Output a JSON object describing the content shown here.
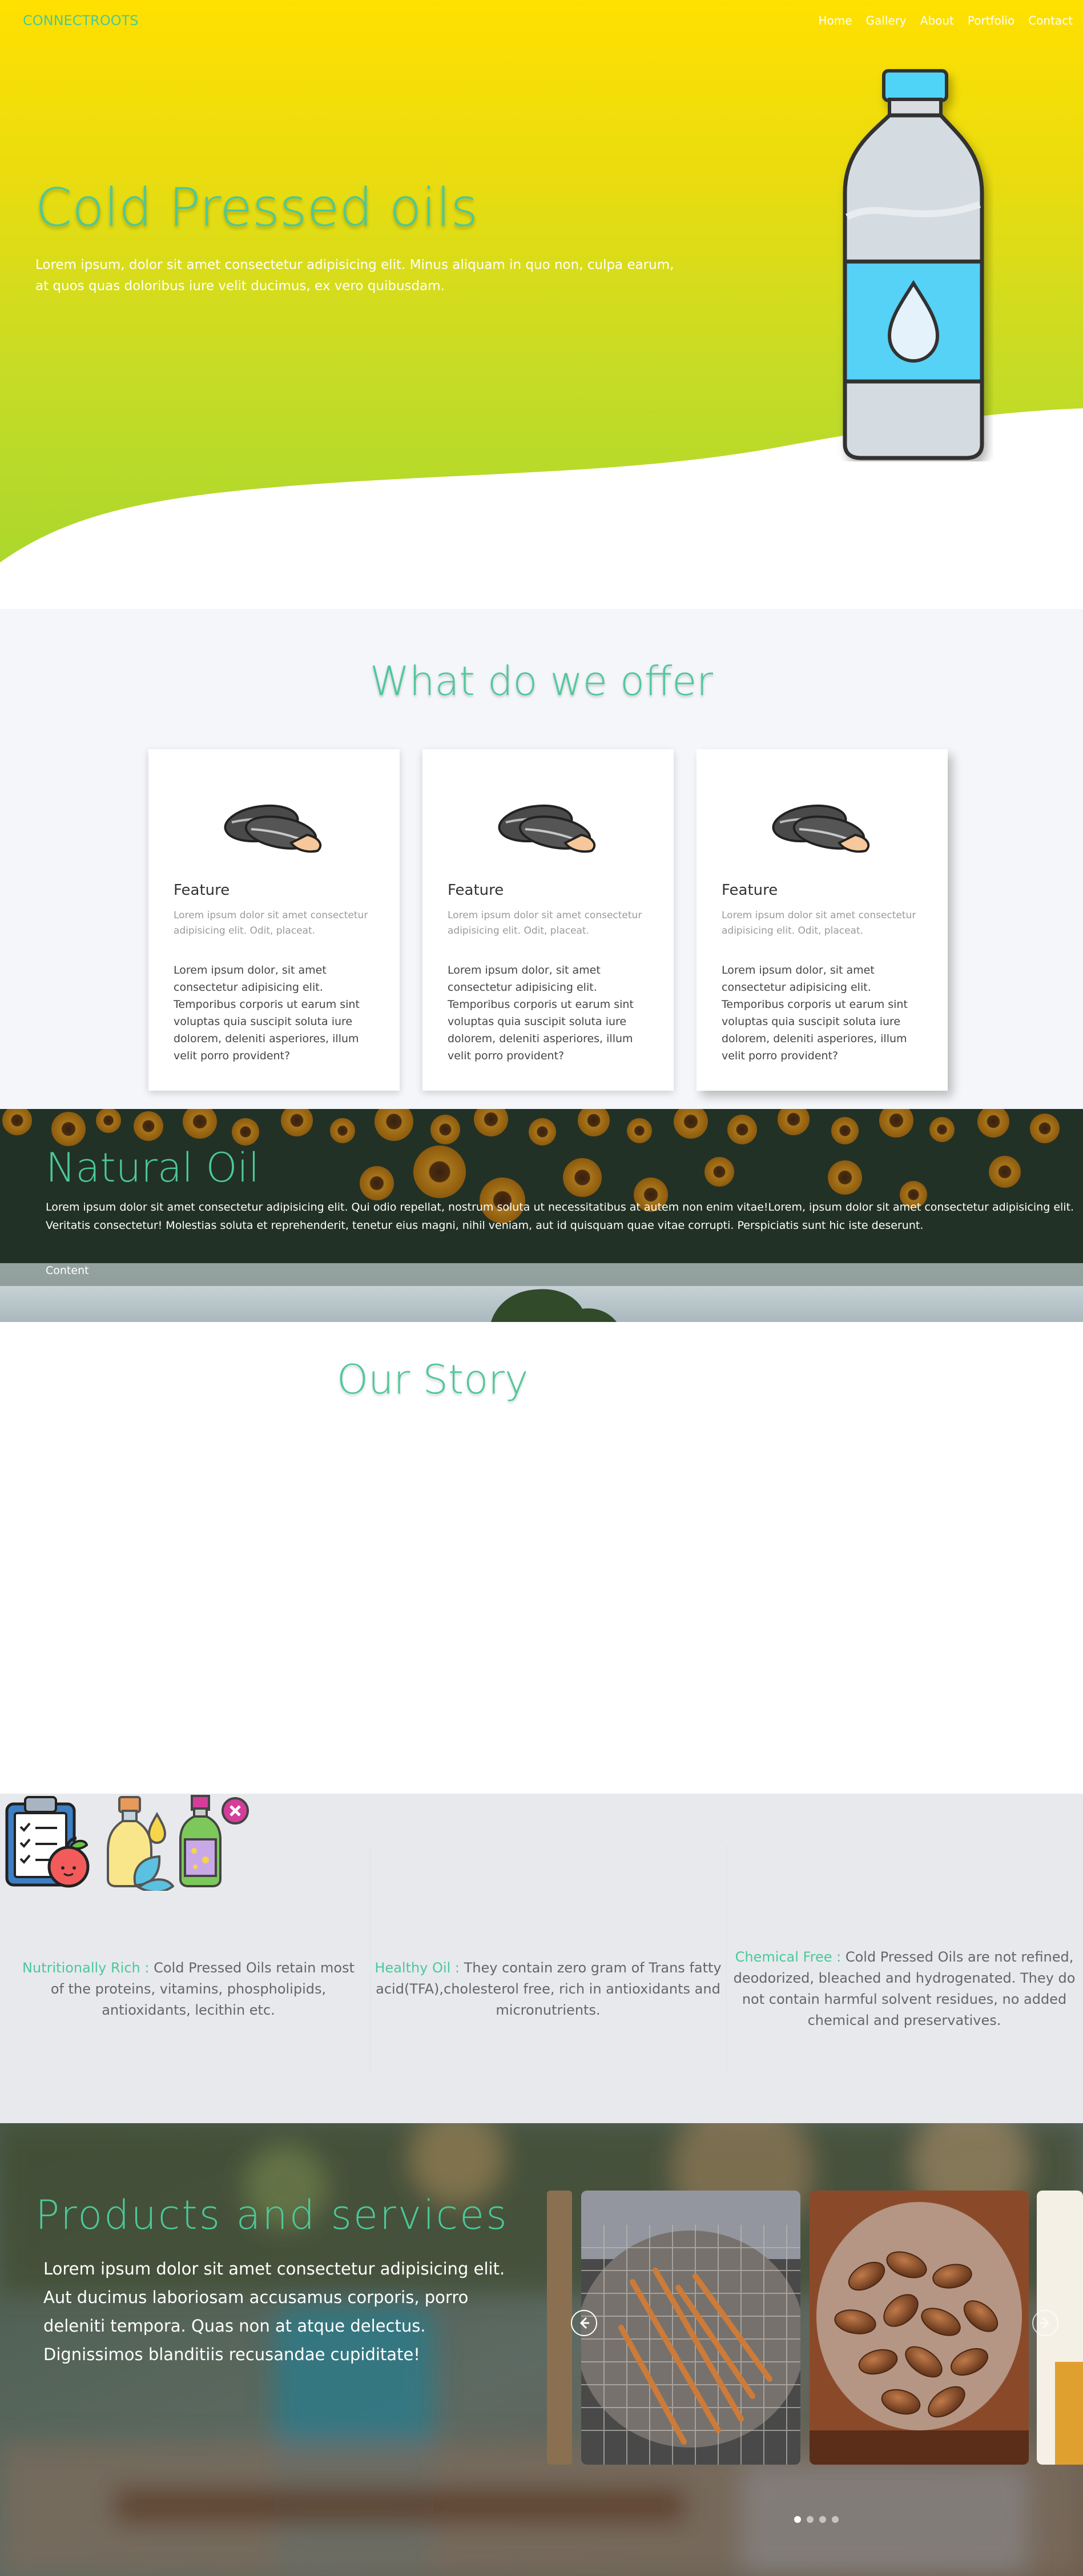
{
  "nav": {
    "brand": "CONNECTROOTS",
    "links": [
      "Home",
      "Gallery",
      "About",
      "Portfolio",
      "Contact"
    ]
  },
  "hero": {
    "title": "Cold Pressed oils",
    "text": "Lorem ipsum, dolor sit amet consectetur adipisicing elit. Minus aliquam in quo non, culpa earum, at quos quas doloribus iure velit ducimus, ex vero quibusdam."
  },
  "offer": {
    "title": "What do we offer",
    "cards": [
      {
        "title": "Feature",
        "subtitle": "Lorem ipsum dolor sit amet consectetur adipisicing elit. Odit, placeat.",
        "body": "Lorem ipsum dolor, sit amet consectetur adipisicing elit. Temporibus corporis ut earum sint voluptas quia suscipit soluta iure dolorem, deleniti asperiores, illum velit porro provident?"
      },
      {
        "title": "Feature",
        "subtitle": "Lorem ipsum dolor sit amet consectetur adipisicing elit. Odit, placeat.",
        "body": "Lorem ipsum dolor, sit amet consectetur adipisicing elit. Temporibus corporis ut earum sint voluptas quia suscipit soluta iure dolorem, deleniti asperiores, illum velit porro provident?"
      },
      {
        "title": "Feature",
        "subtitle": "Lorem ipsum dolor sit amet consectetur adipisicing elit. Odit, placeat.",
        "body": "Lorem ipsum dolor, sit amet consectetur adipisicing elit. Temporibus corporis ut earum sint voluptas quia suscipit soluta iure dolorem, deleniti asperiores, illum velit porro provident?"
      }
    ]
  },
  "natural": {
    "title": "Natural Oil",
    "text": "Lorem ipsum dolor sit amet consectetur adipisicing elit. Qui odio repellat, nostrum soluta ut necessitatibus at autem non enim vitae!Lorem, ipsum dolor sit amet consectetur adipisicing elit. Veritatis consectetur! Molestias soluta et reprehenderit, tenetur eius magni, nihil veniam, aut id quisquam quae vitae corrupti. Perspiciatis sunt hic iste deserunt.",
    "tab": "Content"
  },
  "story": {
    "title": "Our Story"
  },
  "benefits": [
    {
      "highlight": "Nutritionally Rich :",
      "text": " Cold Pressed Oils retain most of the proteins, vitamins, phospholipids, antioxidants, lecithin etc.",
      "icon": "clipboard-apple-icon"
    },
    {
      "highlight": "Healthy Oil :",
      "text": " They contain zero gram of Trans fatty acid(TFA),cholesterol free, rich in antioxidants and micronutrients.",
      "icon": "oil-bottle-leaves-icon"
    },
    {
      "highlight": "Chemical Free :",
      "text": " Cold Pressed Oils are not refined, deodorized, bleached and hydrogenated. They do not contain harmful solvent residues, no added chemical and preservatives.",
      "icon": "chemical-bottle-icon"
    }
  ],
  "products": {
    "title": "Products and services",
    "text": "Lorem ipsum dolor sit amet consectetur adipisicing elit. Aut ducimus laboriosam accusamus corporis, porro deleniti tempora. Quas non at atque delectus. Dignissimos blanditiis recusandae cupiditate!",
    "slides": [
      "frying-food-image",
      "almonds-jar-image"
    ],
    "dots": 4,
    "active_dot": 0
  },
  "colors": {
    "accent": "#4cc89a",
    "hero_top": "#ffe000",
    "hero_bottom": "#a6d62e",
    "section_grey": "#e8e9ec"
  }
}
